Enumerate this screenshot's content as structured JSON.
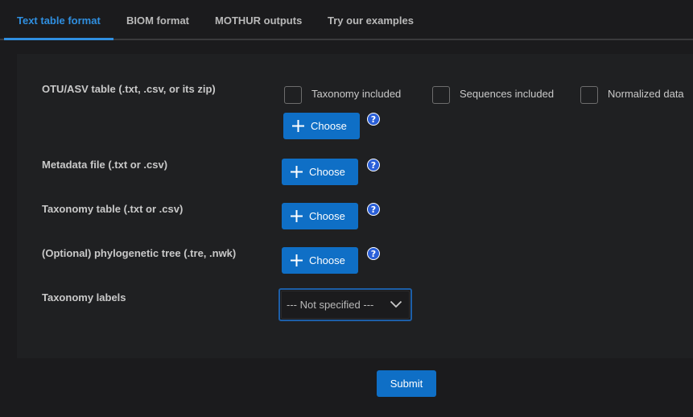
{
  "tabs": [
    {
      "label": "Text table format",
      "active": true
    },
    {
      "label": "BIOM format",
      "active": false
    },
    {
      "label": "MOTHUR outputs",
      "active": false
    },
    {
      "label": "Try our examples",
      "active": false
    }
  ],
  "colors": {
    "accent": "#2f8fe0",
    "button": "#0f6fc6",
    "background": "#1b1b1d",
    "panel": "#1f2022"
  },
  "form": {
    "otu_label": "OTU/ASV table (.txt, .csv, or its zip)",
    "checkboxes": [
      {
        "label": "Taxonomy included",
        "checked": false
      },
      {
        "label": "Sequences included",
        "checked": false
      },
      {
        "label": "Normalized data",
        "checked": false
      }
    ],
    "metadata_label": "Metadata file (.txt or .csv)",
    "taxonomy_table_label": "Taxonomy table (.txt or .csv)",
    "tree_label": "(Optional) phylogenetic tree (.tre, .nwk)",
    "taxonomy_labels_label": "Taxonomy labels",
    "choose_label": "Choose",
    "select_value": "--- Not specified ---",
    "submit_label": "Submit"
  },
  "icons": {
    "plus": "plus-icon",
    "help": "help-icon",
    "chevron": "chevron-down-icon"
  }
}
